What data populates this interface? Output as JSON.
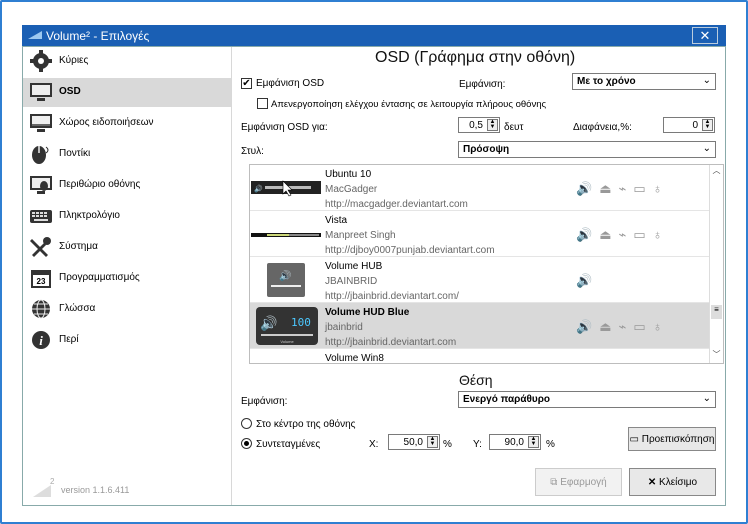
{
  "window": {
    "title": "Volume² - Επιλογές",
    "close_glyph": "✕"
  },
  "sidebar": {
    "items": [
      {
        "label": "Κύριες",
        "icon": "gear-icon"
      },
      {
        "label": "OSD",
        "icon": "monitor-icon"
      },
      {
        "label": "Χώρος ειδοποιήσεων",
        "icon": "tray-icon"
      },
      {
        "label": "Ποντίκι",
        "icon": "mouse-icon"
      },
      {
        "label": "Περιθώριο οθόνης",
        "icon": "screen-edge-icon"
      },
      {
        "label": "Πληκτρολόγιο",
        "icon": "keyboard-icon"
      },
      {
        "label": "Σύστημα",
        "icon": "tools-icon"
      },
      {
        "label": "Προγραμματισμός",
        "icon": "calendar-icon"
      },
      {
        "label": "Γλώσσα",
        "icon": "globe-icon"
      },
      {
        "label": "Περί",
        "icon": "info-icon"
      }
    ],
    "calendar_day": "23",
    "version": "version 1.1.6.411",
    "logo_sup": "2"
  },
  "main": {
    "title": "OSD (Γράφημα στην οθόνη)",
    "show_osd_label": "Εμφάνιση OSD",
    "show_osd_checked": true,
    "display_label": "Εμφάνιση:",
    "display_value": "Με το χρόνο",
    "fullscreen_label": "Απενεργοποίηση ελέγχου έντασης σε λειτουργία πλήρους οθόνης",
    "fullscreen_checked": false,
    "osd_time_label": "Εμφάνιση OSD για:",
    "osd_time_value": "0,5",
    "osd_time_unit": "δευτ",
    "transparency_label": "Διαφάνεια,%:",
    "transparency_value": "0",
    "style_label": "Στυλ:",
    "style_value": "Πρόσοψη",
    "styles": [
      {
        "name": "Ubuntu 10",
        "author": "MacGadger",
        "url": "http://macgadger.deviantart.com"
      },
      {
        "name": "Vista",
        "author": "Manpreet Singh",
        "url": "http://djboy0007punjab.deviantart.com"
      },
      {
        "name": "Volume HUB",
        "author": "JBAINBRID",
        "url": "http://jbainbrid.deviantart.com/"
      },
      {
        "name": "Volume HUD Blue",
        "author": "jbainbrid",
        "url": "http://jbainbrid.deviantart.com"
      },
      {
        "name": "Volume Win8",
        "author": "",
        "url": ""
      }
    ],
    "hud_blue_digits": "100",
    "hud_caption": "Volume",
    "position_title": "Θέση",
    "pos_display_label": "Εμφάνιση:",
    "pos_display_value": "Ενεργό παράθυρο",
    "center_label": "Στο κέντρο της οθόνης",
    "coords_label": "Συντεταγμένες",
    "x_label": "X:",
    "x_value": "50,0",
    "y_label": "Y:",
    "y_value": "90,0",
    "percent": "%",
    "preview_label": "Προεπισκόπηση",
    "apply_label": "Εφαρμογή",
    "close_label": "Κλείσιμο"
  },
  "colors": {
    "titlebar": "#1a5fb4",
    "frame": "#2f7fd2",
    "selection": "#d9d9d9"
  }
}
